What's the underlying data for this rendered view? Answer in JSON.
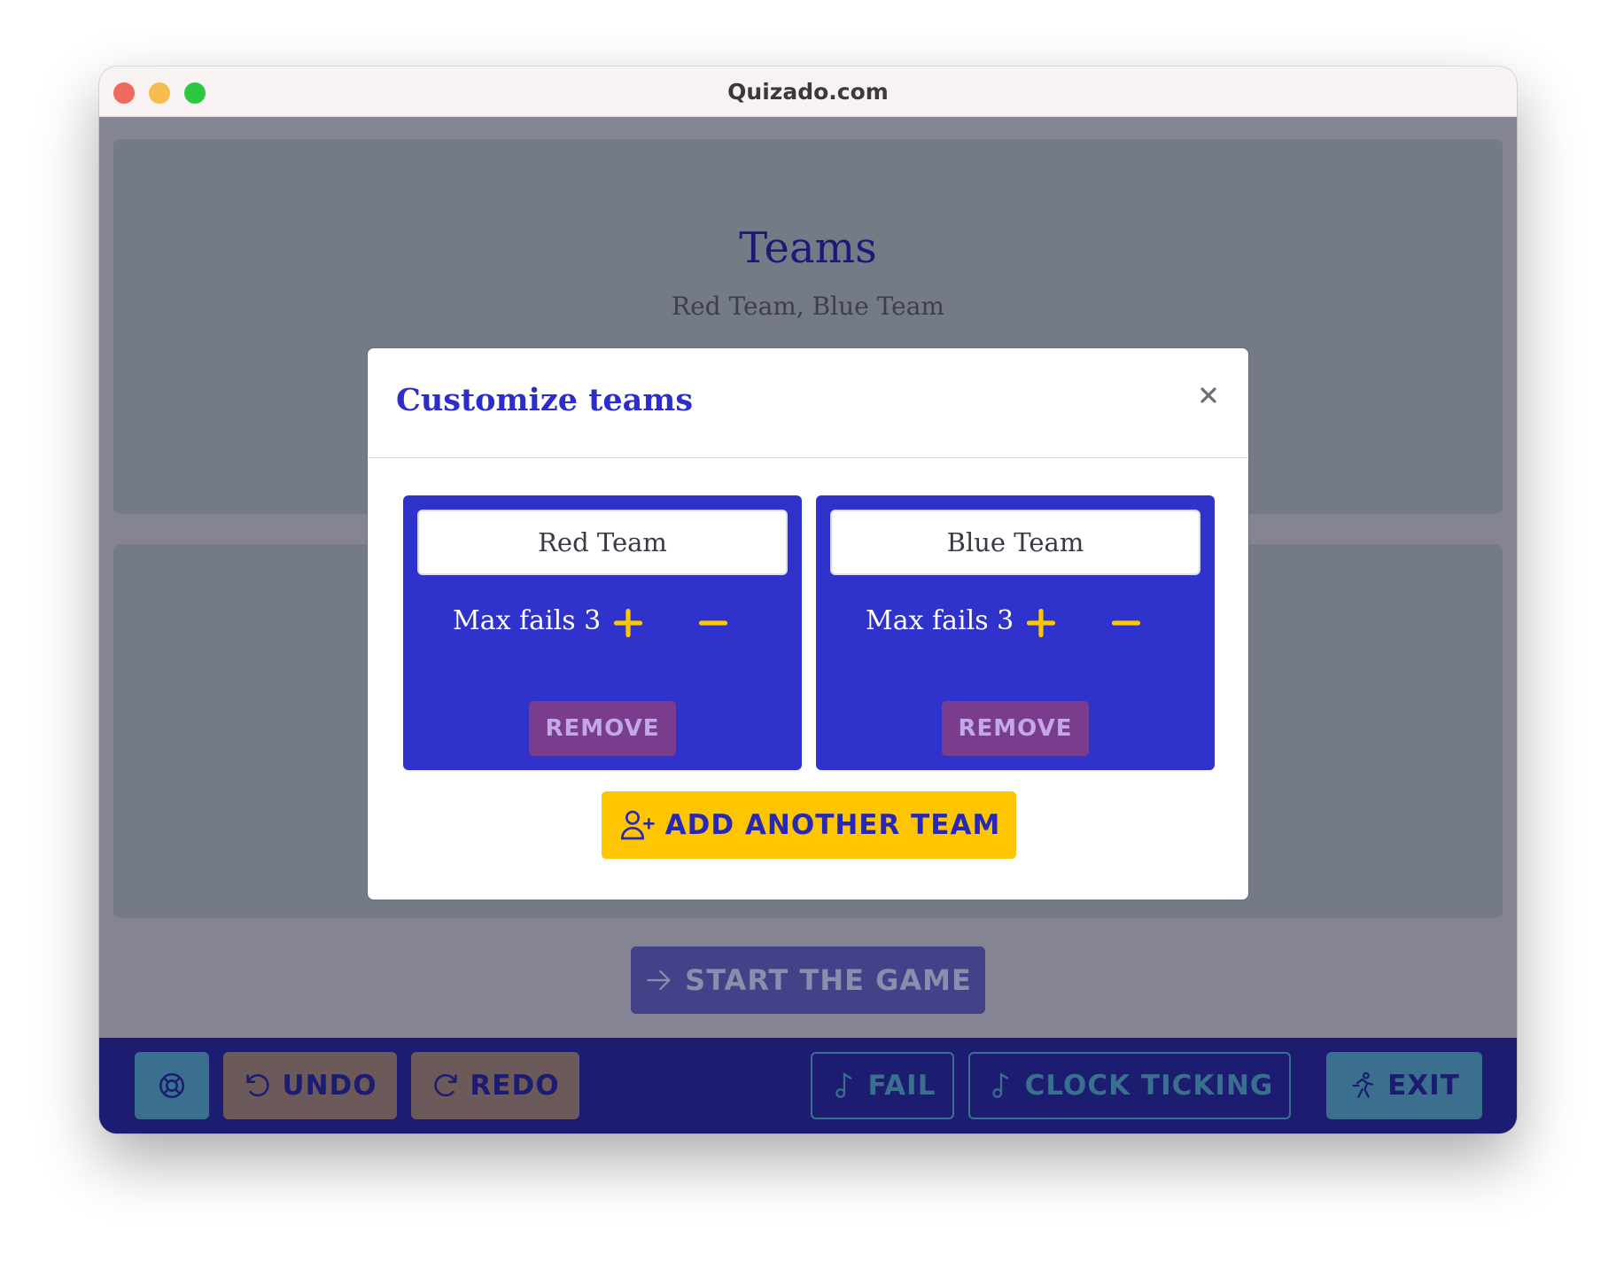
{
  "window": {
    "title": "Quizado.com"
  },
  "background": {
    "heading": "Teams",
    "team_list": "Red Team, Blue Team",
    "start_button": "START THE GAME"
  },
  "modal": {
    "title": "Customize teams",
    "close_icon": "close-icon",
    "teams": [
      {
        "name": "Red Team",
        "max_fails_label": "Max fails 3",
        "remove_label": "REMOVE"
      },
      {
        "name": "Blue Team",
        "max_fails_label": "Max fails 3",
        "remove_label": "REMOVE"
      }
    ],
    "add_team_label": "ADD ANOTHER TEAM"
  },
  "toolbar": {
    "undo": "UNDO",
    "redo": "REDO",
    "fail": "FAIL",
    "clock": "CLOCK TICKING",
    "exit": "EXIT"
  },
  "colors": {
    "team_card": "#2f33cc",
    "accent_yellow": "#fdc601",
    "remove_button": "#7a3c8d",
    "bottom_bar": "#1c1c70"
  }
}
